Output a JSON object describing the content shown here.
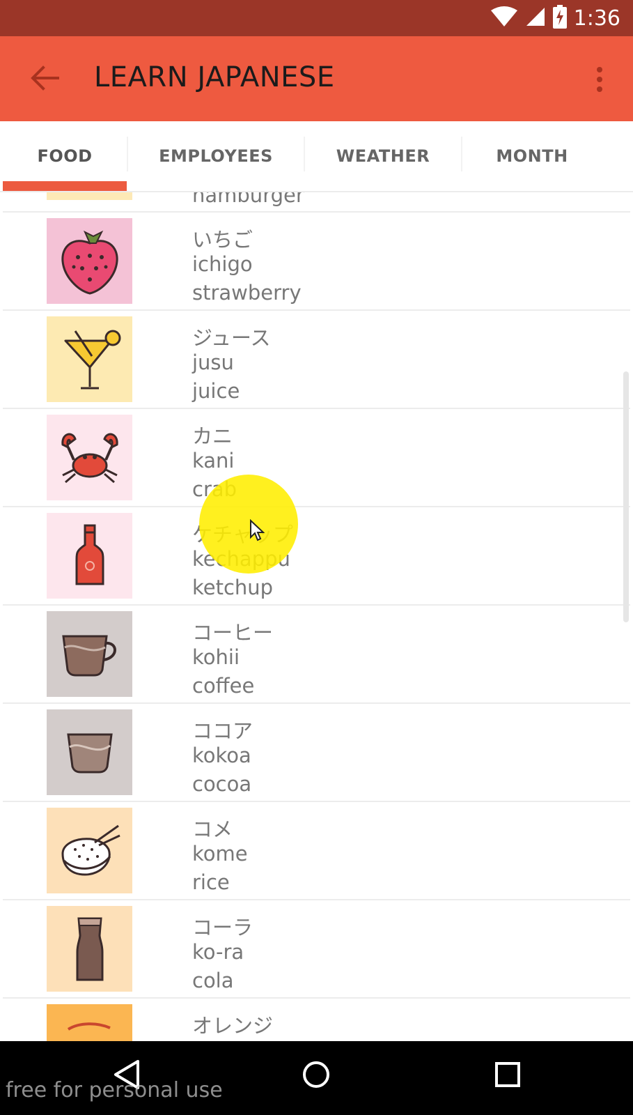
{
  "status_bar": {
    "time": "1:36",
    "icons": [
      "wifi-icon",
      "signal-icon",
      "battery-charging-icon"
    ]
  },
  "app_bar": {
    "title": "LEARN JAPANESE",
    "back_icon": "arrow-left-icon",
    "menu_icon": "more-vert-icon"
  },
  "tabs": [
    {
      "label": "FOOD",
      "selected": true
    },
    {
      "label": "EMPLOYEES",
      "selected": false
    },
    {
      "label": "WEATHER",
      "selected": false
    },
    {
      "label": "MONTH",
      "selected": false
    }
  ],
  "list": {
    "items": [
      {
        "japanese": "",
        "romaji": "",
        "english": "hamburger",
        "icon": "hamburger-icon",
        "bg": "#fde9b6"
      },
      {
        "japanese": "いちご",
        "romaji": "ichigo",
        "english": "strawberry",
        "icon": "strawberry-icon",
        "bg": "#f4c2d6"
      },
      {
        "japanese": "ジュース",
        "romaji": "jusu",
        "english": "juice",
        "icon": "cocktail-icon",
        "bg": "#fdeab2"
      },
      {
        "japanese": "カニ",
        "romaji": "kani",
        "english": "crab",
        "icon": "crab-icon",
        "bg": "#fde6ed"
      },
      {
        "japanese": "ケチャップ",
        "romaji": "kechappu",
        "english": "ketchup",
        "icon": "ketchup-bottle-icon",
        "bg": "#fde6ed"
      },
      {
        "japanese": "コーヒー",
        "romaji": "kohii",
        "english": "coffee",
        "icon": "coffee-cup-icon",
        "bg": "#d3cccb"
      },
      {
        "japanese": "ココア",
        "romaji": "kokoa",
        "english": "cocoa",
        "icon": "cocoa-cup-icon",
        "bg": "#d3cccb"
      },
      {
        "japanese": "コメ",
        "romaji": "kome",
        "english": "rice",
        "icon": "rice-bowl-icon",
        "bg": "#fde0b8"
      },
      {
        "japanese": "コーラ",
        "romaji": "ko-ra",
        "english": "cola",
        "icon": "cola-glass-icon",
        "bg": "#fde0b8"
      },
      {
        "japanese": "オレンジ",
        "romaji": "",
        "english": "",
        "icon": "orange-icon",
        "bg": "#fbb652"
      }
    ]
  },
  "nav_bar": {
    "back_icon": "nav-back-icon",
    "home_icon": "nav-home-icon",
    "recents_icon": "nav-recents-icon"
  },
  "watermark": "free for personal use",
  "colors": {
    "status_bar": "#9b3628",
    "app_bar": "#ee5a40",
    "tab_indicator": "#ec5a3f",
    "text": "#777777"
  }
}
